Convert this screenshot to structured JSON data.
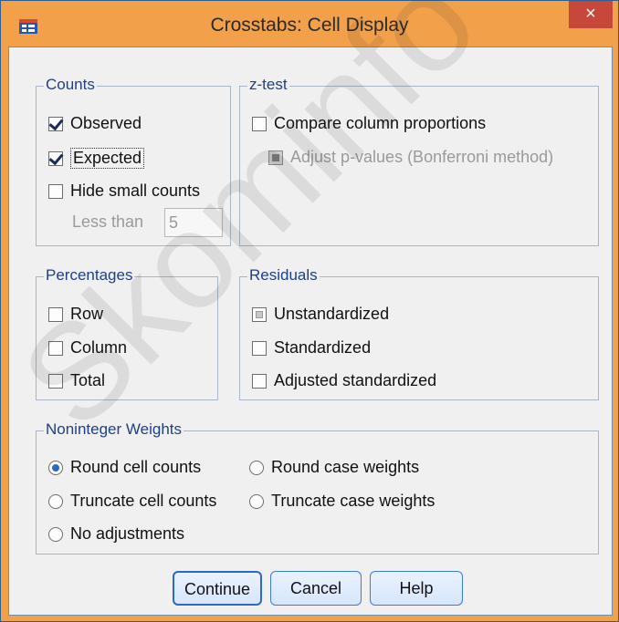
{
  "window": {
    "title": "Crosstabs: Cell Display",
    "close_glyph": "×"
  },
  "groups": {
    "counts": {
      "title": "Counts",
      "observed": "Observed",
      "expected": "Expected",
      "hide_small": "Hide small counts",
      "less_than_label": "Less than",
      "less_than_value": "5"
    },
    "ztest": {
      "title": "z-test",
      "compare": "Compare column proportions",
      "adjust": "Adjust p-values (Bonferroni method)"
    },
    "percentages": {
      "title": "Percentages",
      "row": "Row",
      "column": "Column",
      "total": "Total"
    },
    "residuals": {
      "title": "Residuals",
      "unstandardized": "Unstandardized",
      "standardized": "Standardized",
      "adjusted": "Adjusted standardized"
    },
    "weights": {
      "title": "Noninteger Weights",
      "round_cell": "Round cell counts",
      "round_case": "Round case weights",
      "truncate_cell": "Truncate cell counts",
      "truncate_case": "Truncate case weights",
      "no_adjust": "No adjustments"
    }
  },
  "buttons": {
    "continue": "Continue",
    "cancel": "Cancel",
    "help": "Help"
  },
  "watermark": "Skominfo Ko",
  "colors": {
    "titlebar": "#f2a04a",
    "close": "#c7483a",
    "group_title": "#1f3f8a",
    "button_border": "#3d7bd8"
  }
}
